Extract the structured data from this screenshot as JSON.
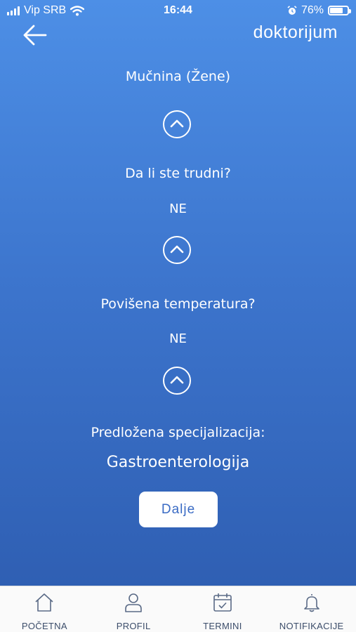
{
  "status_bar": {
    "carrier": "Vip SRB",
    "time": "16:44",
    "battery": "76%",
    "battery_level": 0.76
  },
  "header": {
    "back_icon": "arrow-left-icon",
    "logo": "doktorijum"
  },
  "questions": [
    {
      "title": "Mučnina (Žene)",
      "answer": ""
    },
    {
      "title": "Da li ste trudni?",
      "answer": "NE"
    },
    {
      "title": "Povišena temperatura?",
      "answer": "NE"
    }
  ],
  "toggle_icon": "chevron-up-icon",
  "suggestion": {
    "label": "Predložena specijalizacija:",
    "value": "Gastroenterologija"
  },
  "next_button": "Dalje",
  "tabs": [
    {
      "label": "POČETNA",
      "icon": "home-icon"
    },
    {
      "label": "PROFIL",
      "icon": "user-icon"
    },
    {
      "label": "TERMINI",
      "icon": "calendar-icon"
    },
    {
      "label": "NOTIFIKACIJE",
      "icon": "bell-icon"
    }
  ],
  "colors": {
    "gradient_top": "#4d8fe6",
    "gradient_bottom": "#2f5fb3",
    "button_text": "#3a6bc4",
    "tab_label": "#3c4d6a"
  }
}
